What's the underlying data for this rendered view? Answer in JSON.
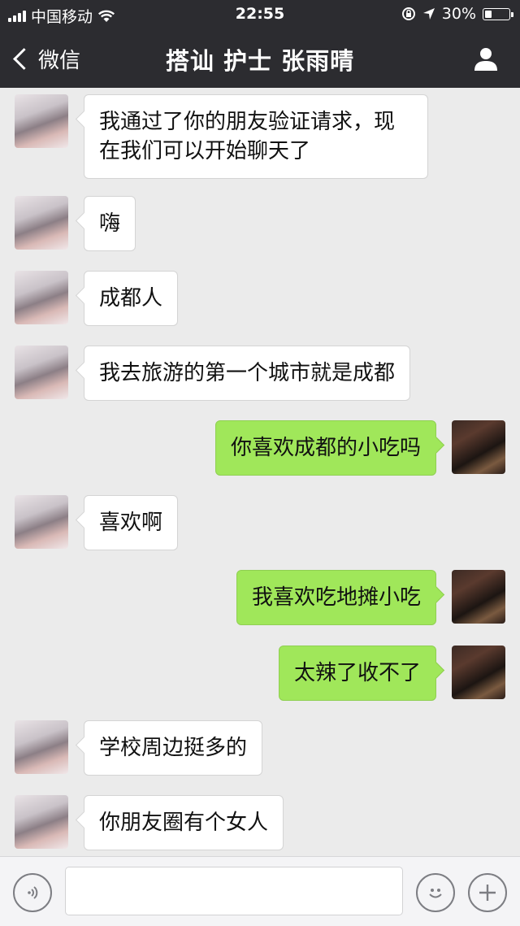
{
  "statusbar": {
    "carrier": "中国移动",
    "time": "22:55",
    "battery_text": "30%",
    "battery_level": 0.3
  },
  "navbar": {
    "back_label": "微信",
    "title": "搭讪 护士 张雨晴"
  },
  "messages": [
    {
      "from": "her",
      "text": "我通过了你的朋友验证请求，现在我们可以开始聊天了"
    },
    {
      "from": "her",
      "text": "嗨"
    },
    {
      "from": "her",
      "text": "成都人"
    },
    {
      "from": "her",
      "text": "我去旅游的第一个城市就是成都"
    },
    {
      "from": "me",
      "text": "你喜欢成都的小吃吗"
    },
    {
      "from": "her",
      "text": "喜欢啊"
    },
    {
      "from": "me",
      "text": "我喜欢吃地摊小吃"
    },
    {
      "from": "me",
      "text": "太辣了收不了"
    },
    {
      "from": "her",
      "text": "学校周边挺多的"
    },
    {
      "from": "her",
      "text": "你朋友圈有个女人"
    }
  ],
  "input": {
    "value": "",
    "placeholder": ""
  },
  "colors": {
    "nav_bg": "#2c2c30",
    "chat_bg": "#ebebeb",
    "bubble_out": "#a0e75a",
    "bubble_in": "#ffffff"
  }
}
